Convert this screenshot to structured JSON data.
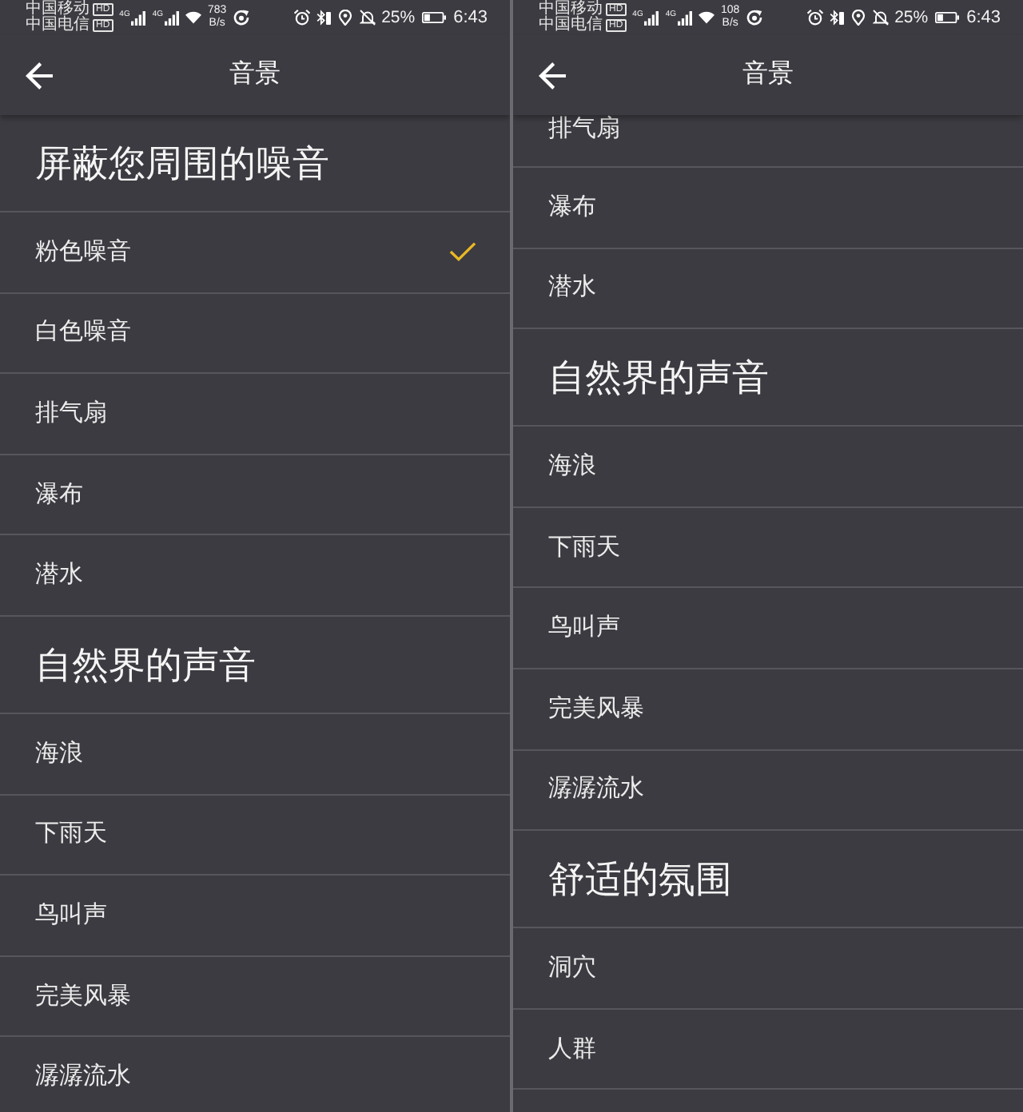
{
  "screens": [
    {
      "status_bar": {
        "carriers": [
          {
            "name": "中国移动",
            "tag": "HD"
          },
          {
            "name": "中国电信",
            "tag": "HD"
          }
        ],
        "signals": [
          {
            "network": "4G"
          },
          {
            "network": "4G"
          }
        ],
        "net_speed": {
          "value": "783",
          "unit": "B/s"
        },
        "battery": "25%",
        "time": "6:43"
      },
      "app_bar": {
        "title": "音景"
      },
      "sections": [
        {
          "title": "屏蔽您周围的噪音",
          "items": [
            {
              "label": "粉色噪音",
              "selected": true
            },
            {
              "label": "白色噪音",
              "selected": false
            },
            {
              "label": "排气扇",
              "selected": false
            },
            {
              "label": "瀑布",
              "selected": false
            },
            {
              "label": "潜水",
              "selected": false
            }
          ]
        },
        {
          "title": "自然界的声音",
          "items": [
            {
              "label": "海浪",
              "selected": false
            },
            {
              "label": "下雨天",
              "selected": false
            },
            {
              "label": "鸟叫声",
              "selected": false
            },
            {
              "label": "完美风暴",
              "selected": false
            },
            {
              "label": "潺潺流水",
              "selected": false
            }
          ]
        }
      ]
    },
    {
      "status_bar": {
        "carriers": [
          {
            "name": "中国移动",
            "tag": "HD"
          },
          {
            "name": "中国电信",
            "tag": "HD"
          }
        ],
        "signals": [
          {
            "network": "4G"
          },
          {
            "network": "4G"
          }
        ],
        "net_speed": {
          "value": "108",
          "unit": "B/s"
        },
        "battery": "25%",
        "time": "6:43"
      },
      "app_bar": {
        "title": "音景"
      },
      "sections": [
        {
          "items": [
            {
              "label": "排气扇",
              "selected": false
            },
            {
              "label": "瀑布",
              "selected": false
            },
            {
              "label": "潜水",
              "selected": false
            }
          ]
        },
        {
          "title": "自然界的声音",
          "items": [
            {
              "label": "海浪",
              "selected": false
            },
            {
              "label": "下雨天",
              "selected": false
            },
            {
              "label": "鸟叫声",
              "selected": false
            },
            {
              "label": "完美风暴",
              "selected": false
            },
            {
              "label": "潺潺流水",
              "selected": false
            }
          ]
        },
        {
          "title": "舒适的氛围",
          "items": [
            {
              "label": "洞穴",
              "selected": false
            },
            {
              "label": "人群",
              "selected": false
            }
          ]
        }
      ]
    }
  ]
}
